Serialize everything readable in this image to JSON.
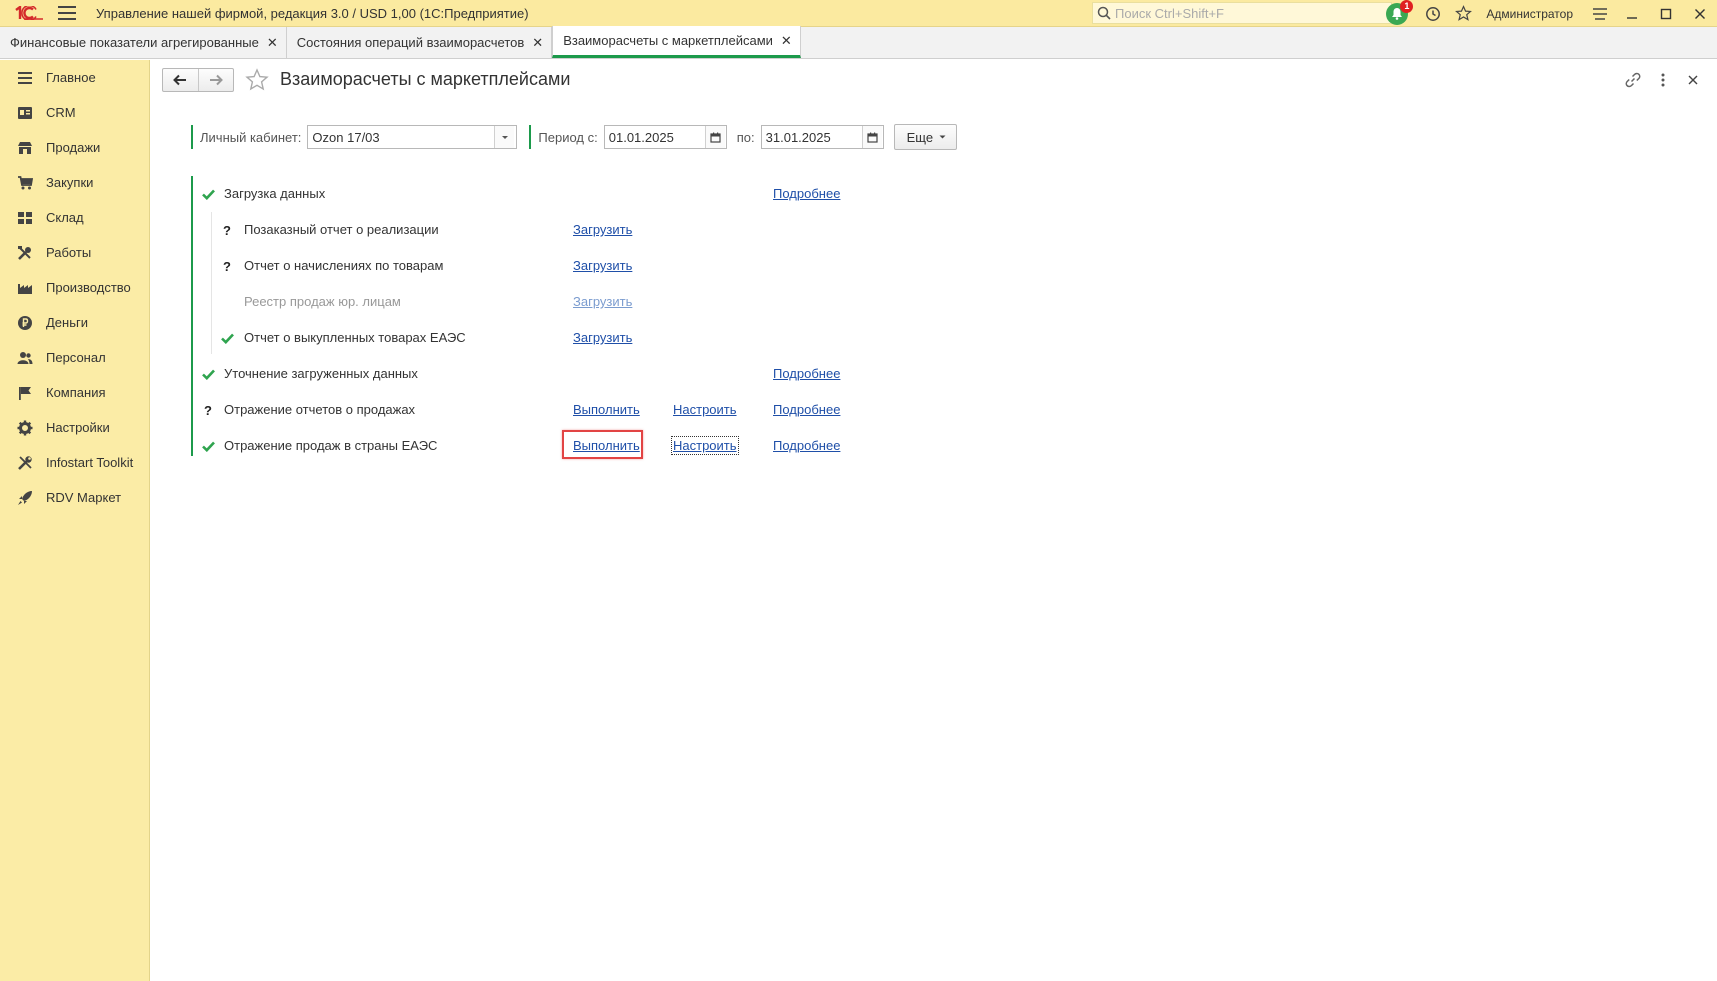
{
  "window": {
    "title": "Управление нашей фирмой, редакция 3.0 / USD 1,00  (1С:Предприятие)",
    "search_placeholder": "Поиск Ctrl+Shift+F",
    "notifications_count": "1",
    "user": "Администратор"
  },
  "tabs": [
    {
      "label": "Финансовые показатели агрегированные",
      "active": false
    },
    {
      "label": "Состояния операций взаиморасчетов",
      "active": false
    },
    {
      "label": "Взаиморасчеты с маркетплейсами",
      "active": true
    }
  ],
  "sidebar": {
    "items": [
      {
        "label": "Главное",
        "icon": "menu-lines-icon"
      },
      {
        "label": "CRM",
        "icon": "crm-card-icon"
      },
      {
        "label": "Продажи",
        "icon": "shop-icon"
      },
      {
        "label": "Закупки",
        "icon": "cart-icon"
      },
      {
        "label": "Склад",
        "icon": "warehouse-grid-icon"
      },
      {
        "label": "Работы",
        "icon": "tools-icon"
      },
      {
        "label": "Производство",
        "icon": "factory-icon"
      },
      {
        "label": "Деньги",
        "icon": "ruble-coin-icon"
      },
      {
        "label": "Персонал",
        "icon": "people-icon"
      },
      {
        "label": "Компания",
        "icon": "flag-icon"
      },
      {
        "label": "Настройки",
        "icon": "gear-icon"
      },
      {
        "label": "Infostart Toolkit",
        "icon": "wrench-icon"
      },
      {
        "label": "RDV Маркет",
        "icon": "rocket-icon"
      }
    ]
  },
  "page": {
    "title": "Взаиморасчеты с маркетплейсами"
  },
  "filters": {
    "account_label": "Личный кабинет:",
    "account_value": "Ozon 17/03",
    "period_from_label": "Период с:",
    "period_from_value": "01.01.2025",
    "period_to_label": "по:",
    "period_to_value": "31.01.2025",
    "more_label": "Еще"
  },
  "steps": {
    "load": {
      "label": "Загрузка данных",
      "status": "done",
      "details": "Подробнее"
    },
    "sub": [
      {
        "label": "Позаказный отчет о реализации",
        "status": "unknown",
        "action": "Загрузить"
      },
      {
        "label": "Отчет о начислениях по товарам",
        "status": "unknown",
        "action": "Загрузить"
      },
      {
        "label": "Реестр продаж юр. лицам",
        "status": "disabled",
        "action": "Загрузить"
      },
      {
        "label": "Отчет о выкупленных товарах ЕАЭС",
        "status": "done",
        "action": "Загрузить"
      }
    ],
    "refine": {
      "label": "Уточнение загруженных данных",
      "status": "done",
      "details": "Подробнее"
    },
    "reports": {
      "label": "Отражение отчетов о продажах",
      "status": "unknown",
      "action": "Выполнить",
      "setup": "Настроить",
      "details": "Подробнее"
    },
    "eaeu": {
      "label": "Отражение продаж в страны ЕАЭС",
      "status": "done",
      "action": "Выполнить",
      "setup": "Настроить",
      "details": "Подробнее"
    }
  },
  "colors": {
    "accent_green": "#1c9a4b",
    "sidebar_bg": "#fbeca6",
    "link_blue": "#1f4fa8",
    "highlight_red": "#e24444"
  }
}
